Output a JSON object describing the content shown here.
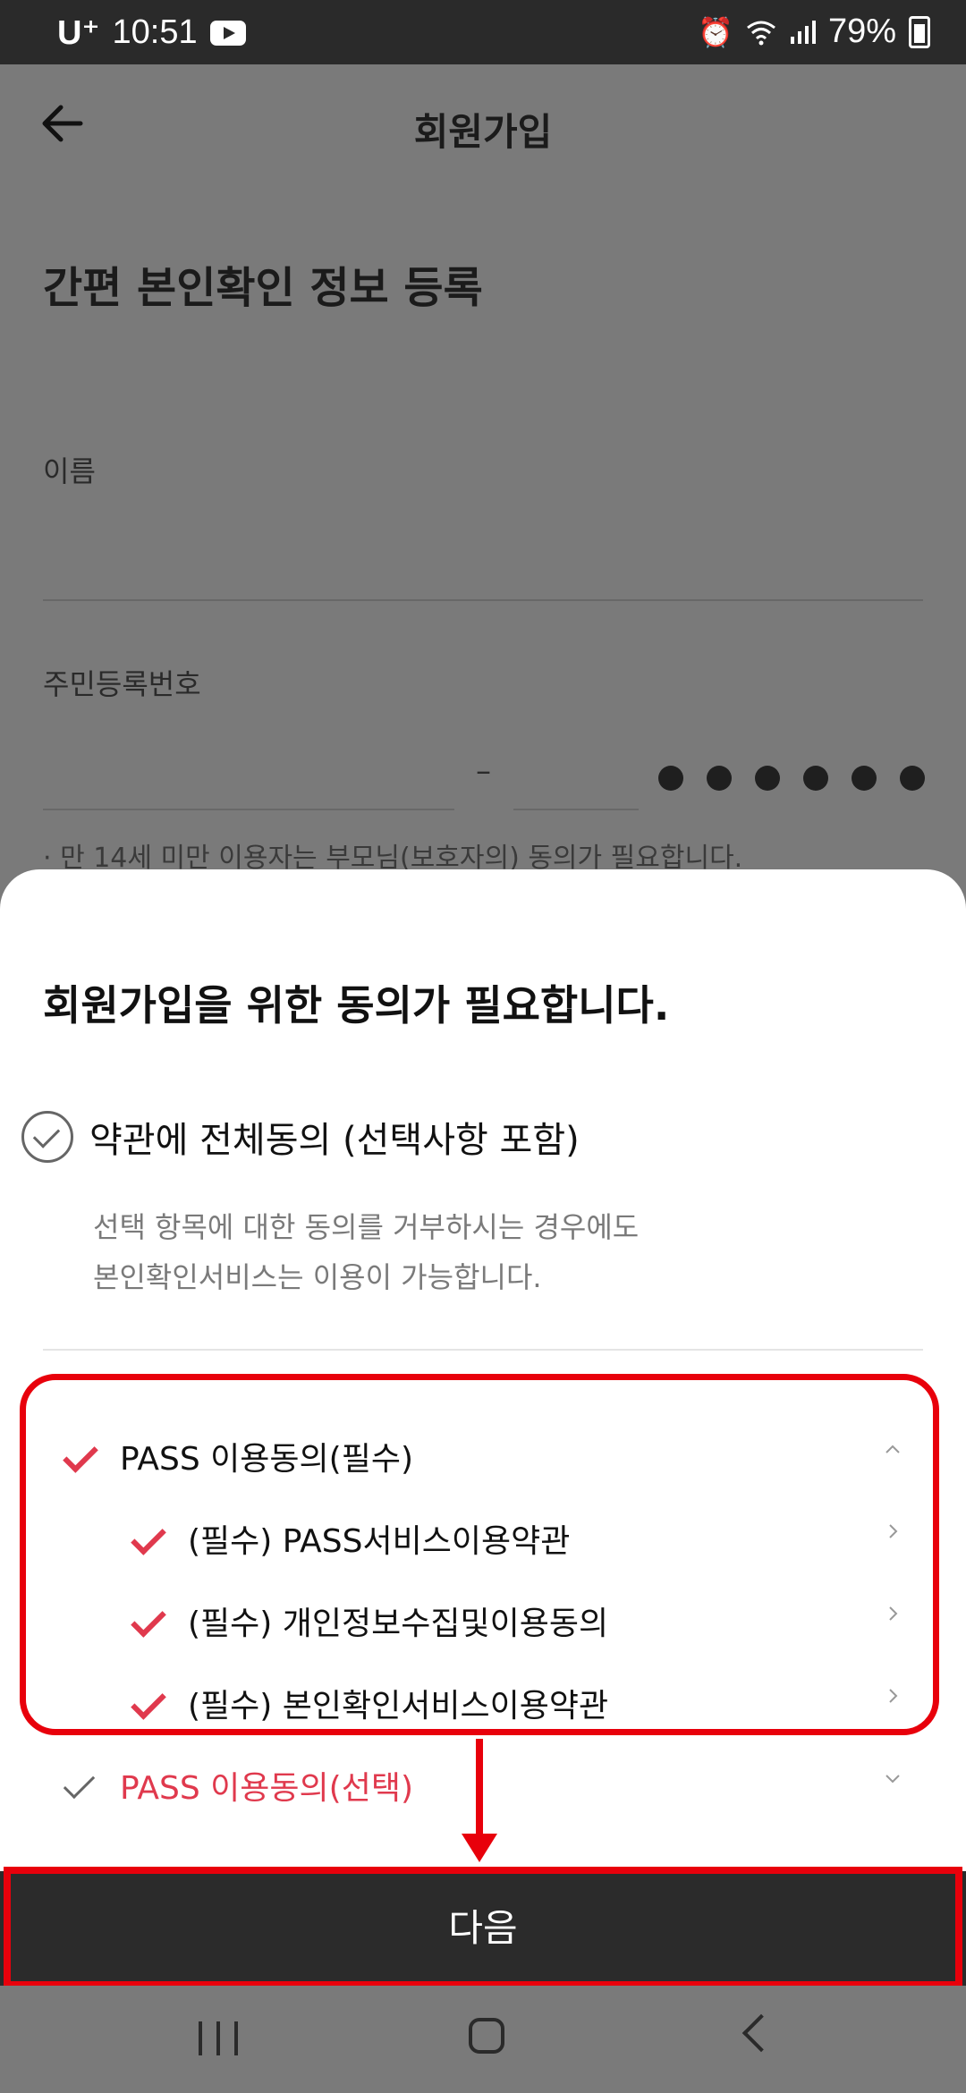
{
  "status_bar": {
    "carrier": "U⁺",
    "time": "10:51",
    "battery": "79%",
    "icons": [
      "youtube-icon",
      "alarm-icon",
      "wifi-icon",
      "signal-icon",
      "battery-icon"
    ]
  },
  "header": {
    "title": "회원가입",
    "back_icon": "back-arrow-icon"
  },
  "form": {
    "section_title": "간편 본인확인 정보 등록",
    "name_label": "이름",
    "name_value": "",
    "rrn_label": "주민등록번호",
    "rrn_dash": "–",
    "rrn_masked_digits": 6,
    "note": "· 만 14세 미만 이용자는 부모님(보호자의) 동의가 필요합니다."
  },
  "sheet": {
    "title": "회원가입을 위한 동의가 필요합니다.",
    "agree_all_label": "약관에 전체동의 (선택사항 포함)",
    "hint_line1": "선택 항목에 대한 동의를 거부하시는 경우에도",
    "hint_line2": "본인확인서비스는 이용이 가능합니다.",
    "required_group": {
      "label": "PASS 이용동의(필수)",
      "items": [
        {
          "label": "(필수) PASS서비스이용약관"
        },
        {
          "label": "(필수) 개인정보수집및이용동의"
        },
        {
          "label": "(필수) 본인확인서비스이용약관"
        }
      ]
    },
    "optional_group": {
      "label": "PASS 이용동의(선택)"
    },
    "next_button": "다음"
  },
  "colors": {
    "accent_red": "#e0394d",
    "highlight_red": "#e8000b",
    "button_dark": "#2b2b2b"
  }
}
